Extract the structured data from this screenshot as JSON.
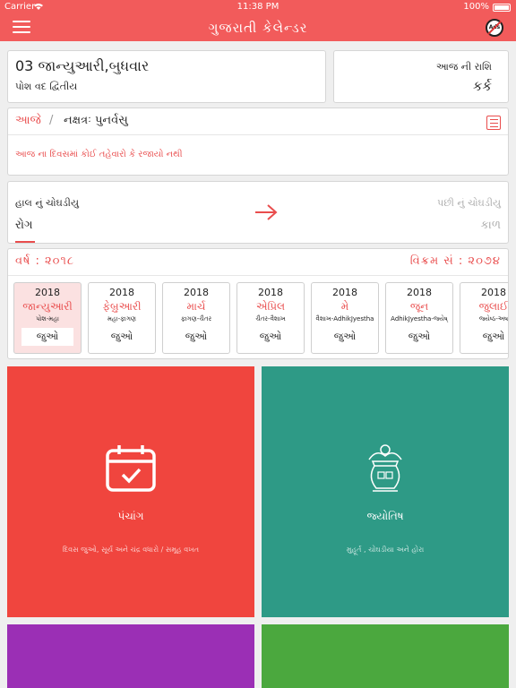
{
  "status": {
    "carrier": "Carrier",
    "time": "11:38 PM",
    "battery": "100%"
  },
  "header": {
    "title": "ગુજરાતી કેલેન્ડર",
    "menu_icon": "hamburger-icon",
    "ads_icon": "no-ads-icon",
    "ads_label": "Ads"
  },
  "today": {
    "date": "03  જાન્યુઆરી,બુધવાર",
    "tithi": "પોશ વદ દ્વિતીય"
  },
  "rashi": {
    "label": "આજ ની રાશિ",
    "value": "કર્ક"
  },
  "nakshatra": {
    "today_label": "આજે",
    "separator": "/",
    "text": "નક્ષત્રઃ પુનર્વસુ",
    "festivals": "આજ ના દિવસમાં કોઈ તહેવારો કે રજાયો નથી"
  },
  "choghadiya": {
    "current_label": "હાલ નું ચોઘડીયુ",
    "current_value": "રોગ",
    "next_label": "પછી નું ચોઘડીયુ",
    "next_value": "કાળ"
  },
  "calendar": {
    "year_label": "વર્ષ : ૨૦૧૮",
    "vikram_label": "વિક્રમ સં : ૨૦૭૪",
    "months": [
      {
        "year": "2018",
        "name": "જાન્યુઆરી",
        "sub": "પોશ-મહા",
        "see": "જુઓ"
      },
      {
        "year": "2018",
        "name": "ફેબ્રુઆરી",
        "sub": "મહા-ફાગણ",
        "see": "જુઓ"
      },
      {
        "year": "2018",
        "name": "માર્ચ",
        "sub": "ફાગણ-ચૈતર",
        "see": "જુઓ"
      },
      {
        "year": "2018",
        "name": "એપ્રિલ",
        "sub": "ચૈતર-વૈશાખ",
        "see": "જુઓ"
      },
      {
        "year": "2018",
        "name": "મે",
        "sub": "વૈશાખ-AdhikJyestha",
        "see": "જુઓ"
      },
      {
        "year": "2018",
        "name": "જૂન",
        "sub": "AdhikJyestha-જ્યેષ્",
        "see": "જુઓ"
      },
      {
        "year": "2018",
        "name": "જુલાઈ",
        "sub": "જ્યેષ્ઠ-અષ",
        "see": "જુઓ"
      }
    ]
  },
  "tiles": {
    "panchang": {
      "title": "પંચાંગ",
      "subtitle": "દિવસ જુઓ, સૂર્ય અને ચંદ્ર વધારો / સમૂહ વખત",
      "icon": "calendar-check-icon",
      "color": "#f0453e"
    },
    "jyotish": {
      "title": "જ્યોતિષ",
      "subtitle": "મુહૂર્ત , ચોઘડીયા અને હોરા",
      "icon": "kalash-icon",
      "color": "#2e9a86"
    },
    "tile3": {
      "color": "#9b2fb5"
    },
    "tile4": {
      "color": "#4ba83e"
    }
  },
  "colors": {
    "accent": "#f25b5b",
    "text_red": "#e94d4d"
  }
}
